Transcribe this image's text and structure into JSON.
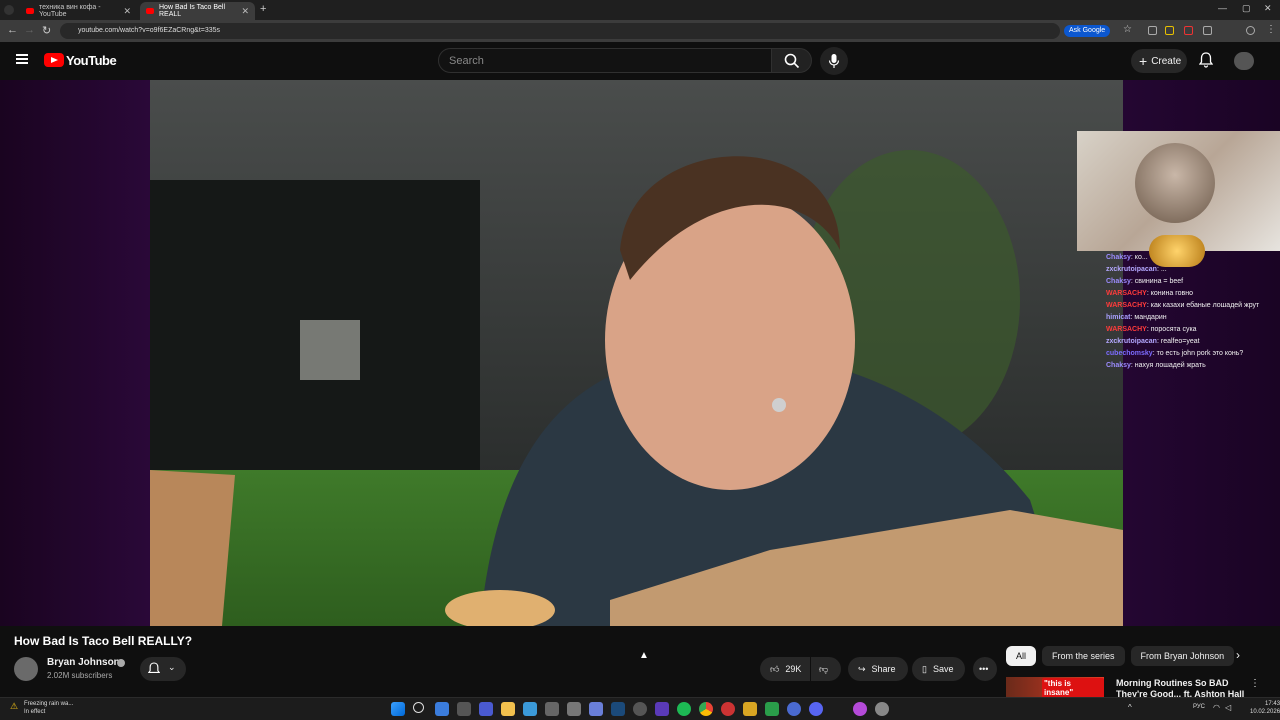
{
  "browser": {
    "tabs": [
      {
        "title": "техника вин кофа - YouTube",
        "active": false
      },
      {
        "title": "How Bad Is Taco Bell REALL",
        "active": true
      }
    ],
    "new_tab": "+",
    "url": "youtube.com/watch?v=o9f6EZaCRng&t=335s",
    "ask_google": "Ask Google"
  },
  "header": {
    "logo_text": "YouTube",
    "search_placeholder": "Search",
    "create_label": "Create"
  },
  "chat": {
    "messages": [
      {
        "user": "Chaksy",
        "text": "ко...",
        "color": "#9c8cff"
      },
      {
        "user": "zxckrutoipacan",
        "text": "...",
        "color": "#b4a8ff"
      },
      {
        "user": "Chaksy",
        "text": "свинина = beef",
        "color": "#9c8cff"
      },
      {
        "user": "WARSACHY",
        "text": "конина говно",
        "color": "#ff3b3b"
      },
      {
        "user": "WARSACHY",
        "text": "как казахи ебаные лошадей жрут",
        "color": "#ff3b3b"
      },
      {
        "user": "himicat",
        "text": "мандарин",
        "color": "#a9a0ff"
      },
      {
        "user": "WARSACHY",
        "text": "поросята сука",
        "color": "#ff3b3b"
      },
      {
        "user": "zxckrutoipacan",
        "text": "realfeo=yeat",
        "color": "#b4a8ff"
      },
      {
        "user": "cubechomsky",
        "text": "то есть john pork это конь?",
        "color": "#7c6cff"
      },
      {
        "user": "Chaksy",
        "text": "нахуя лошадей жрать",
        "color": "#9c8cff"
      }
    ]
  },
  "video": {
    "title": "How Bad Is Taco Bell REALLY?",
    "channel": "Bryan Johnson",
    "subscribers": "2.02M subscribers",
    "likes": "29K",
    "share_label": "Share",
    "save_label": "Save"
  },
  "chips": [
    "All",
    "From the series",
    "From Bryan Johnson"
  ],
  "recommendation": {
    "thumb_text": "\"this is insane\"",
    "title": "Morning Routines So BAD They're Good... ft. Ashton Hall"
  },
  "taskbar": {
    "weather_line1": "Freezing rain wa...",
    "weather_line2": "In effect",
    "lang": "РУС",
    "time": "17:43",
    "date": "10.02.2026"
  },
  "colors": {
    "youtube_red": "#ff0000",
    "accent_blue": "#0b57d0"
  }
}
